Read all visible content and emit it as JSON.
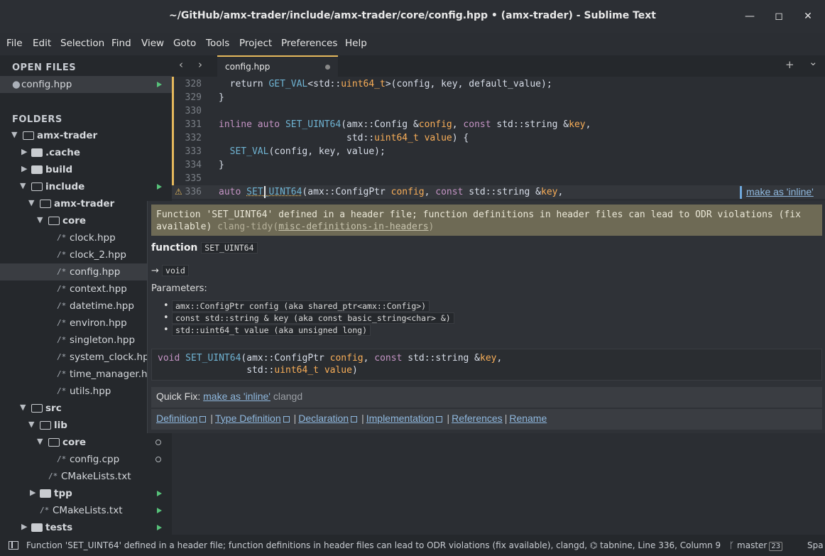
{
  "window": {
    "title": "~/GitHub/amx-trader/include/amx-trader/core/config.hpp • (amx-trader) - Sublime Text",
    "controls": {
      "minimize": "—",
      "maximize": "◻",
      "close": "✕"
    }
  },
  "menu": [
    "File",
    "Edit",
    "Selection",
    "Find",
    "View",
    "Goto",
    "Tools",
    "Project",
    "Preferences",
    "Help"
  ],
  "sidebar": {
    "open_files_heading": "OPEN FILES",
    "open_files": [
      {
        "name": "config.hpp",
        "badge": "modified"
      }
    ],
    "folders_heading": "FOLDERS",
    "tree": [
      {
        "name": "amx-trader",
        "type": "folder-open",
        "depth": 0
      },
      {
        "name": ".cache",
        "type": "folder",
        "depth": 1
      },
      {
        "name": "build",
        "type": "folder",
        "depth": 1
      },
      {
        "name": "include",
        "type": "folder-open",
        "depth": 1
      },
      {
        "name": "amx-trader",
        "type": "folder-open",
        "depth": 2
      },
      {
        "name": "core",
        "type": "folder-open",
        "depth": 3
      },
      {
        "name": "clock.hpp",
        "type": "file",
        "depth": 4
      },
      {
        "name": "clock_2.hpp",
        "type": "file",
        "depth": 4
      },
      {
        "name": "config.hpp",
        "type": "file",
        "depth": 4
      },
      {
        "name": "context.hpp",
        "type": "file",
        "depth": 4
      },
      {
        "name": "datetime.hpp",
        "type": "file",
        "depth": 4
      },
      {
        "name": "environ.hpp",
        "type": "file",
        "depth": 4
      },
      {
        "name": "singleton.hpp",
        "type": "file",
        "depth": 4
      },
      {
        "name": "system_clock.hpp",
        "type": "file",
        "depth": 4
      },
      {
        "name": "time_manager.hpp",
        "type": "file",
        "depth": 4
      },
      {
        "name": "utils.hpp",
        "type": "file",
        "depth": 4
      },
      {
        "name": "src",
        "type": "folder-open",
        "depth": 1
      },
      {
        "name": "lib",
        "type": "folder-open",
        "depth": 2
      },
      {
        "name": "core",
        "type": "folder-open",
        "depth": 3
      },
      {
        "name": "config.cpp",
        "type": "file",
        "depth": 4
      },
      {
        "name": "CMakeLists.txt",
        "type": "file",
        "depth": 3
      },
      {
        "name": "tpp",
        "type": "folder",
        "depth": 2
      },
      {
        "name": "CMakeLists.txt",
        "type": "file",
        "depth": 2
      },
      {
        "name": "tests",
        "type": "folder",
        "depth": 1
      }
    ],
    "file_glyph": "/*"
  },
  "tabs": {
    "back": "‹",
    "forward": "›",
    "active_tab": "config.hpp",
    "new_tab": "+",
    "tab_menu": "⌄"
  },
  "editor": {
    "line_numbers": [
      "328",
      "329",
      "330",
      "331",
      "332",
      "333",
      "334",
      "335",
      "336"
    ],
    "lines": {
      "l328": {
        "a": "  return ",
        "b": "GET_VAL",
        "c": "<std::",
        "d": "uint64_t",
        "e": ">(config, key, default_value);"
      },
      "l329": "}",
      "l330": "",
      "l331": {
        "a": "inline",
        "b": " ",
        "c": "auto",
        "d": " ",
        "e": "SET_UINT64",
        "f": "(amx::Config &",
        "g": "config",
        "h": ", ",
        "i": "const",
        "j": " std::string &",
        "k": "key",
        "l": ","
      },
      "l332": {
        "a": "                       std::",
        "b": "uint64_t",
        "c": " ",
        "d": "value",
        "e": ") {"
      },
      "l333": {
        "a": "  ",
        "b": "SET_VAL",
        "c": "(config, key, value);"
      },
      "l334": "}",
      "l335": "",
      "l336": {
        "a": "auto",
        "b": " ",
        "c": "SET_UINT64",
        "d": "(amx::ConfigPtr ",
        "e": "config",
        "f": ", ",
        "g": "const",
        "h": " std::string &",
        "i": "key",
        "j": ","
      },
      "warning_icon": "⚠",
      "inline_hint": "make as 'inline'"
    }
  },
  "popup": {
    "diagnostic": "Function 'SET_UINT64' defined in a header file; function definitions in header files can lead to ODR violations (fix available)",
    "diagnostic_source": "clang-tidy(",
    "diagnostic_code": "misc-definitions-in-headers",
    "diagnostic_close": ")",
    "kind": "function",
    "name": "SET_UINT64",
    "returns_arrow": "→",
    "returns": "void",
    "parameters_label": "Parameters:",
    "parameters": [
      "amx::ConfigPtr config (aka shared_ptr<amx::Config>)",
      "const std::string & key (aka const basic_string<char> &)",
      "std::uint64_t value (aka unsigned long)"
    ],
    "bullet": "•",
    "signature": {
      "l1a": "void ",
      "l1b": "SET_UINT64",
      "l1c": "(amx::ConfigPtr ",
      "l1d": "config",
      "l1e": ", ",
      "l1f": "const",
      "l1g": " std::string &",
      "l1h": "key",
      "l1i": ",",
      "l2a": "                std::",
      "l2b": "uint64_t",
      "l2c": " ",
      "l2d": "value",
      "l2e": ")"
    },
    "quick_fix_label": "Quick Fix:",
    "quick_fix_action": "make as 'inline'",
    "quick_fix_source": "clangd",
    "actions": [
      "Definition",
      "Type Definition",
      "Declaration",
      "Implementation",
      "References",
      "Rename"
    ],
    "action_separator": "|"
  },
  "status": {
    "message": "Function 'SET_UINT64' defined in a header file; function definitions in header files can lead to ODR violations (fix available), clangd, ⌬ tabnine, Line 336, Column 9",
    "branch_icon": "ᚴ",
    "branch": "master",
    "branch_count": "23",
    "right": "Spa"
  },
  "colors": {
    "accent": "#e5b85c",
    "keyword": "#c594c5",
    "function": "#6fb3d2",
    "type": "#f9ae58",
    "link": "#8fb8de",
    "git_added": "#57c27a"
  }
}
